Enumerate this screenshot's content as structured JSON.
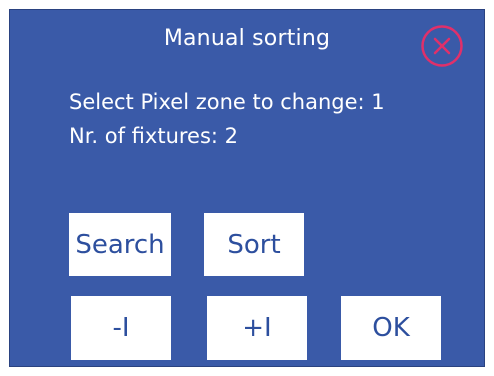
{
  "dialog": {
    "title": "Manual sorting",
    "close_icon": "close-circle-x-icon",
    "lines": {
      "zone": "Select Pixel zone to change: 1",
      "fixtures": "Nr. of fixtures: 2"
    },
    "buttons": {
      "search": "Search",
      "sort": "Sort",
      "decrement": "-I",
      "increment": "+I",
      "ok": "OK"
    }
  },
  "colors": {
    "panel_background": "#3a5aa8",
    "text": "#ffffff",
    "button_background": "#ffffff",
    "button_text": "#2d4f9e",
    "close_icon": "#e0306a"
  }
}
